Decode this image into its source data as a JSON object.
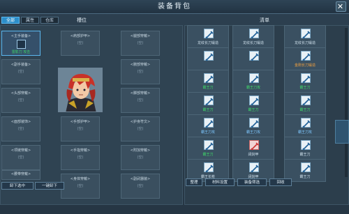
{
  "window": {
    "title": "装备背包",
    "close": "✕"
  },
  "tabs": [
    {
      "label": "全部"
    },
    {
      "label": "属性"
    },
    {
      "label": "仓库"
    }
  ],
  "left": {
    "heading": "槽位",
    "slots": [
      {
        "label": "<主手装备>",
        "sub": "",
        "eq": "雷影刀 攻击",
        "selected": true
      },
      {
        "label": "<副手装备>",
        "sub": "(空)"
      },
      {
        "label": "<头部穿戴>",
        "sub": "(空)"
      },
      {
        "label": "<面部装饰>",
        "sub": "(空)"
      },
      {
        "label": "<项链穿戴>",
        "sub": "(空)"
      },
      {
        "label": "<腰带穿戴>",
        "sub": "(空)"
      },
      {
        "label": "<肩部护甲>",
        "sub": "(空)"
      },
      {
        "label": "<手部护甲>",
        "sub": "(空)"
      },
      {
        "label": "<手指穿戴>",
        "sub": "(空)"
      },
      {
        "label": "<身体穿戴>",
        "sub": "(空)"
      },
      {
        "label": "<腿部穿戴>",
        "sub": "(空)"
      },
      {
        "label": "<腕部穿戴>",
        "sub": "(空)"
      },
      {
        "label": "<脚部穿戴>",
        "sub": "(空)"
      },
      {
        "label": "<护身符文>",
        "sub": "(空)"
      },
      {
        "label": "<附加穿戴>",
        "sub": "(空)"
      },
      {
        "label": "<副武器装>",
        "sub": "(空)"
      }
    ],
    "buttons": {
      "unequip": "卸下选中",
      "unequip_all": "一键卸下"
    }
  },
  "right": {
    "heading": "清单",
    "items": [
      {
        "name": "龙纹长刀锻造",
        "color": "white"
      },
      {
        "name": "龙纹长刀锻造",
        "color": "white"
      },
      {
        "name": "龙纹长刀锻造",
        "color": "white"
      },
      {
        "name": "",
        "color": "white"
      },
      {
        "name": "",
        "color": "white"
      },
      {
        "name": "金刚长刀锻造",
        "color": "orange"
      },
      {
        "name": "霸王刀",
        "color": "green"
      },
      {
        "name": "霸王刀攻",
        "color": "green"
      },
      {
        "name": "霸王刀",
        "color": "green"
      },
      {
        "name": "霸王刀",
        "color": "green"
      },
      {
        "name": "霸王刀",
        "color": "green"
      },
      {
        "name": "霸王刀",
        "color": "green"
      },
      {
        "name": "霸王刀攻",
        "color": "blue"
      },
      {
        "name": "霸王刀攻",
        "color": "blue"
      },
      {
        "name": "霸王刀攻",
        "color": "blue"
      },
      {
        "name": "霸王刀",
        "color": "green"
      },
      {
        "name": "阔剑甲",
        "color": "white",
        "red": true
      },
      {
        "name": "霸王刀",
        "color": "white"
      },
      {
        "name": "霸王长枪",
        "color": "white"
      },
      {
        "name": "阔剑甲",
        "color": "white"
      },
      {
        "name": "霸王刀",
        "color": "white"
      }
    ],
    "buttons": [
      "整理",
      "材料设置",
      "装备筛选",
      "回收"
    ]
  }
}
